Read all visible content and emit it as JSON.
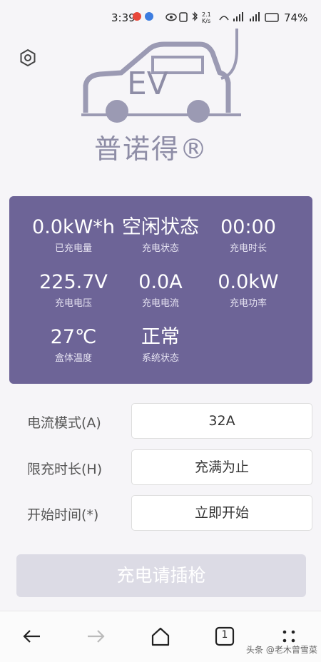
{
  "status_bar": {
    "time": "3:39",
    "network_speed": "2.1 K/s",
    "battery": "74%"
  },
  "brand": {
    "logo_text": "EV",
    "name": "普诺得®"
  },
  "stats": [
    {
      "value": "0.0kW*h",
      "label": "已充电量"
    },
    {
      "value": "空闲状态",
      "label": "充电状态"
    },
    {
      "value": "00:00",
      "label": "充电时长"
    },
    {
      "value": "225.7V",
      "label": "充电电压"
    },
    {
      "value": "0.0A",
      "label": "充电电流"
    },
    {
      "value": "0.0kW",
      "label": "充电功率"
    },
    {
      "value": "27℃",
      "label": "盒体温度"
    },
    {
      "value": "正常",
      "label": "系统状态"
    }
  ],
  "settings": [
    {
      "label": "电流模式(A)",
      "value": "32A"
    },
    {
      "label": "限充时长(H)",
      "value": "充满为止"
    },
    {
      "label": "开始时间(*)",
      "value": "立即开始"
    }
  ],
  "charge_button": "充电请插枪",
  "navbar": {
    "tab_count": "1"
  },
  "watermark": "头条 @老木曾雪菜",
  "icons": {
    "settings": "gear-icon",
    "back": "arrow-left-icon",
    "forward": "arrow-right-icon",
    "home": "home-icon",
    "tabs": "tabs-icon",
    "menu": "dots-icon"
  },
  "colors": {
    "panel": "#6d6497",
    "logo": "#8e8da6",
    "button_disabled": "#dcdbe5"
  }
}
